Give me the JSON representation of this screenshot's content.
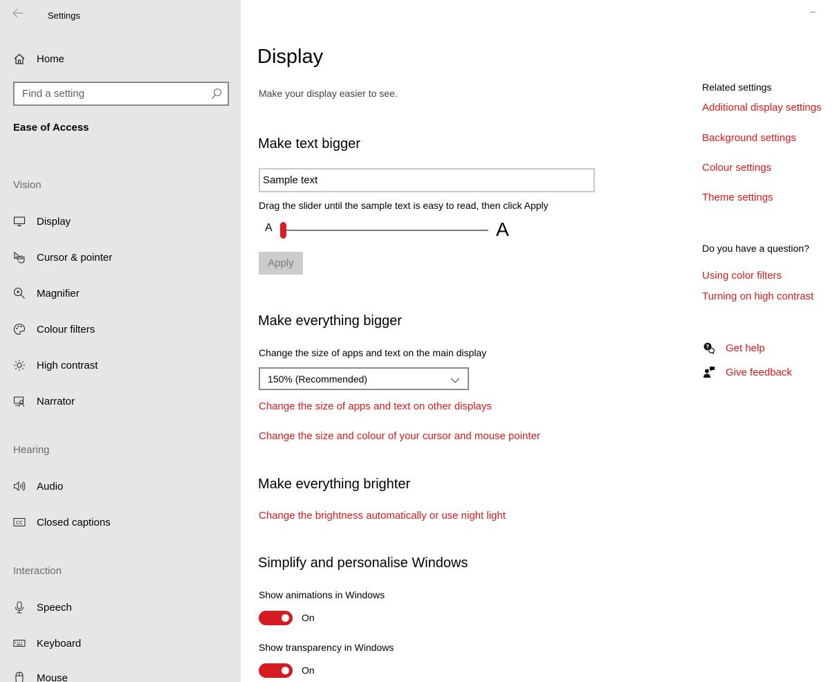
{
  "window": {
    "title": "Settings",
    "minimize_glyph": "–"
  },
  "sidebar": {
    "home_label": "Home",
    "search_placeholder": "Find a setting",
    "section_title": "Ease of Access",
    "groups": {
      "vision": "Vision",
      "hearing": "Hearing",
      "interaction": "Interaction"
    },
    "items": [
      {
        "label": "Display",
        "icon": "monitor-icon"
      },
      {
        "label": "Cursor & pointer",
        "icon": "cursor-pointer-icon"
      },
      {
        "label": "Magnifier",
        "icon": "magnifier-icon"
      },
      {
        "label": "Colour filters",
        "icon": "colour-filters-icon"
      },
      {
        "label": "High contrast",
        "icon": "high-contrast-icon"
      },
      {
        "label": "Narrator",
        "icon": "narrator-icon"
      },
      {
        "label": "Audio",
        "icon": "audio-icon"
      },
      {
        "label": "Closed captions",
        "icon": "closed-captions-icon"
      },
      {
        "label": "Speech",
        "icon": "microphone-icon"
      },
      {
        "label": "Keyboard",
        "icon": "keyboard-icon"
      },
      {
        "label": "Mouse",
        "icon": "mouse-icon"
      }
    ]
  },
  "main": {
    "title": "Display",
    "subtitle": "Make your display easier to see.",
    "text_bigger": {
      "heading": "Make text bigger",
      "sample_text": "Sample text",
      "hint": "Drag the slider until the sample text is easy to read, then click Apply",
      "small_a": "A",
      "large_a": "A",
      "slider_percent": 0,
      "apply_label": "Apply"
    },
    "everything_bigger": {
      "heading": "Make everything bigger",
      "label": "Change the size of apps and text on the main display",
      "dropdown_value": "150% (Recommended)",
      "link_other_displays": "Change the size of apps and text on other displays",
      "link_cursor": "Change the size and colour of your cursor and mouse pointer"
    },
    "brighter": {
      "heading": "Make everything brighter",
      "link": "Change the brightness automatically or use night light"
    },
    "simplify": {
      "heading": "Simplify and personalise Windows",
      "animations_label": "Show animations in Windows",
      "animations_state": "On",
      "transparency_label": "Show transparency in Windows",
      "transparency_state": "On"
    }
  },
  "related": {
    "title": "Related settings",
    "links": [
      "Additional display settings",
      "Background settings",
      "Colour settings",
      "Theme settings"
    ],
    "question_title": "Do you have a question?",
    "question_links": [
      "Using color filters",
      "Turning on high contrast"
    ],
    "get_help": "Get help",
    "give_feedback": "Give feedback"
  },
  "colors": {
    "accent": "#d81a1a",
    "sidebar_bg": "#e6e6e6",
    "toggle_on": "#d61b22"
  }
}
